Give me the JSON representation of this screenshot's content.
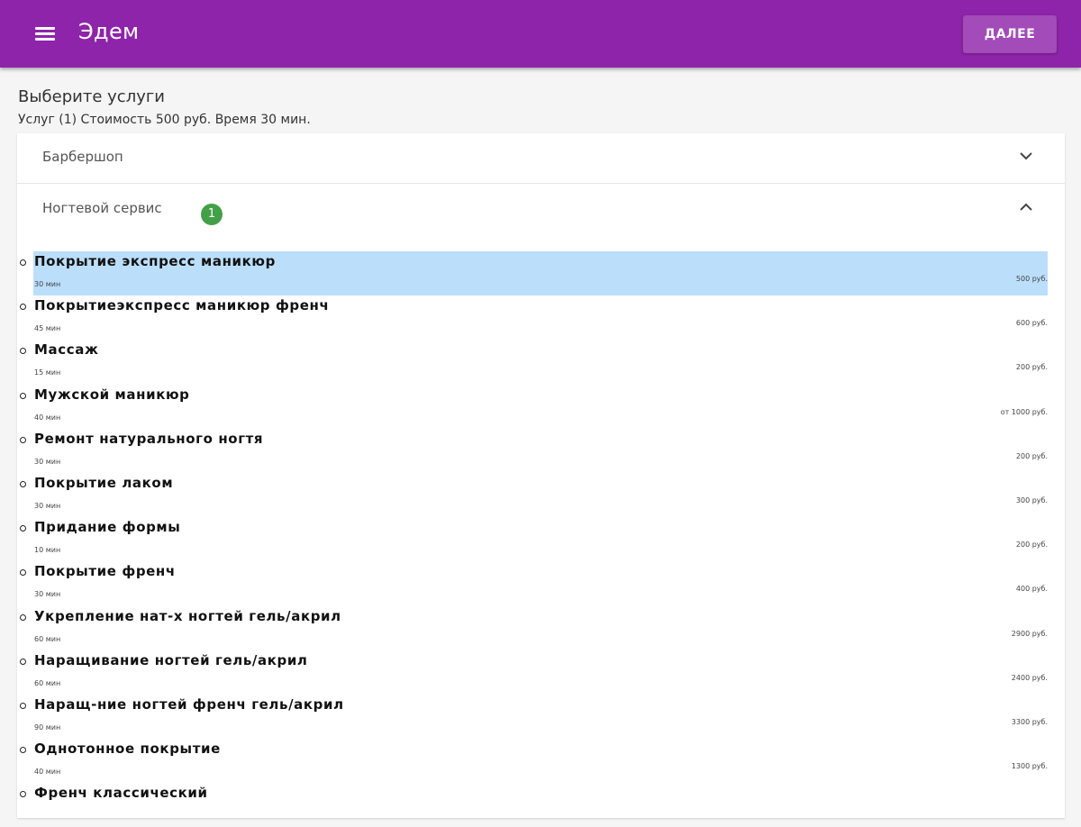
{
  "appbar": {
    "title": "Эдем",
    "next_label": "ДАЛЕЕ",
    "color": "#8e24aa"
  },
  "heading": "Выберите услуги",
  "summary": "Услуг (1) Стоимость 500 руб. Время 30 мин.",
  "categories": [
    {
      "label": "Барбершоп",
      "expanded": false
    },
    {
      "label": "Ногтевой сервис",
      "expanded": true,
      "badge": "1"
    }
  ],
  "services": [
    {
      "name": "Покрытие экспресс маникюр",
      "duration": "30 мин",
      "price": "500 руб.",
      "selected": true
    },
    {
      "name": "Покрытиеэкспресс маникюр френч",
      "duration": "45 мин",
      "price": "600 руб.",
      "selected": false
    },
    {
      "name": "Массаж",
      "duration": "15 мин",
      "price": "200 руб.",
      "selected": false
    },
    {
      "name": "Мужской маникюр",
      "duration": "40 мин",
      "price": "от 1000 руб.",
      "selected": false
    },
    {
      "name": "Ремонт натурального ногтя",
      "duration": "30 мин",
      "price": "200 руб.",
      "selected": false
    },
    {
      "name": "Покрытие лаком",
      "duration": "30 мин",
      "price": "300 руб.",
      "selected": false
    },
    {
      "name": "Придание формы",
      "duration": "10 мин",
      "price": "200 руб.",
      "selected": false
    },
    {
      "name": "Покрытие френч",
      "duration": "30 мин",
      "price": "400 руб.",
      "selected": false
    },
    {
      "name": "Укрепление нат-х ногтей гель/акрил",
      "duration": "60 мин",
      "price": "2900 руб.",
      "selected": false
    },
    {
      "name": "Наращивание ногтей гель/акрил",
      "duration": "60 мин",
      "price": "2400 руб.",
      "selected": false
    },
    {
      "name": "Наращ-ние ногтей френч гель/акрил",
      "duration": "90 мин",
      "price": "3300 руб.",
      "selected": false
    },
    {
      "name": "Однотонное покрытие",
      "duration": "40 мин",
      "price": "1300 руб.",
      "selected": false
    },
    {
      "name": "Френч классический",
      "duration": "",
      "price": "",
      "selected": false
    }
  ]
}
